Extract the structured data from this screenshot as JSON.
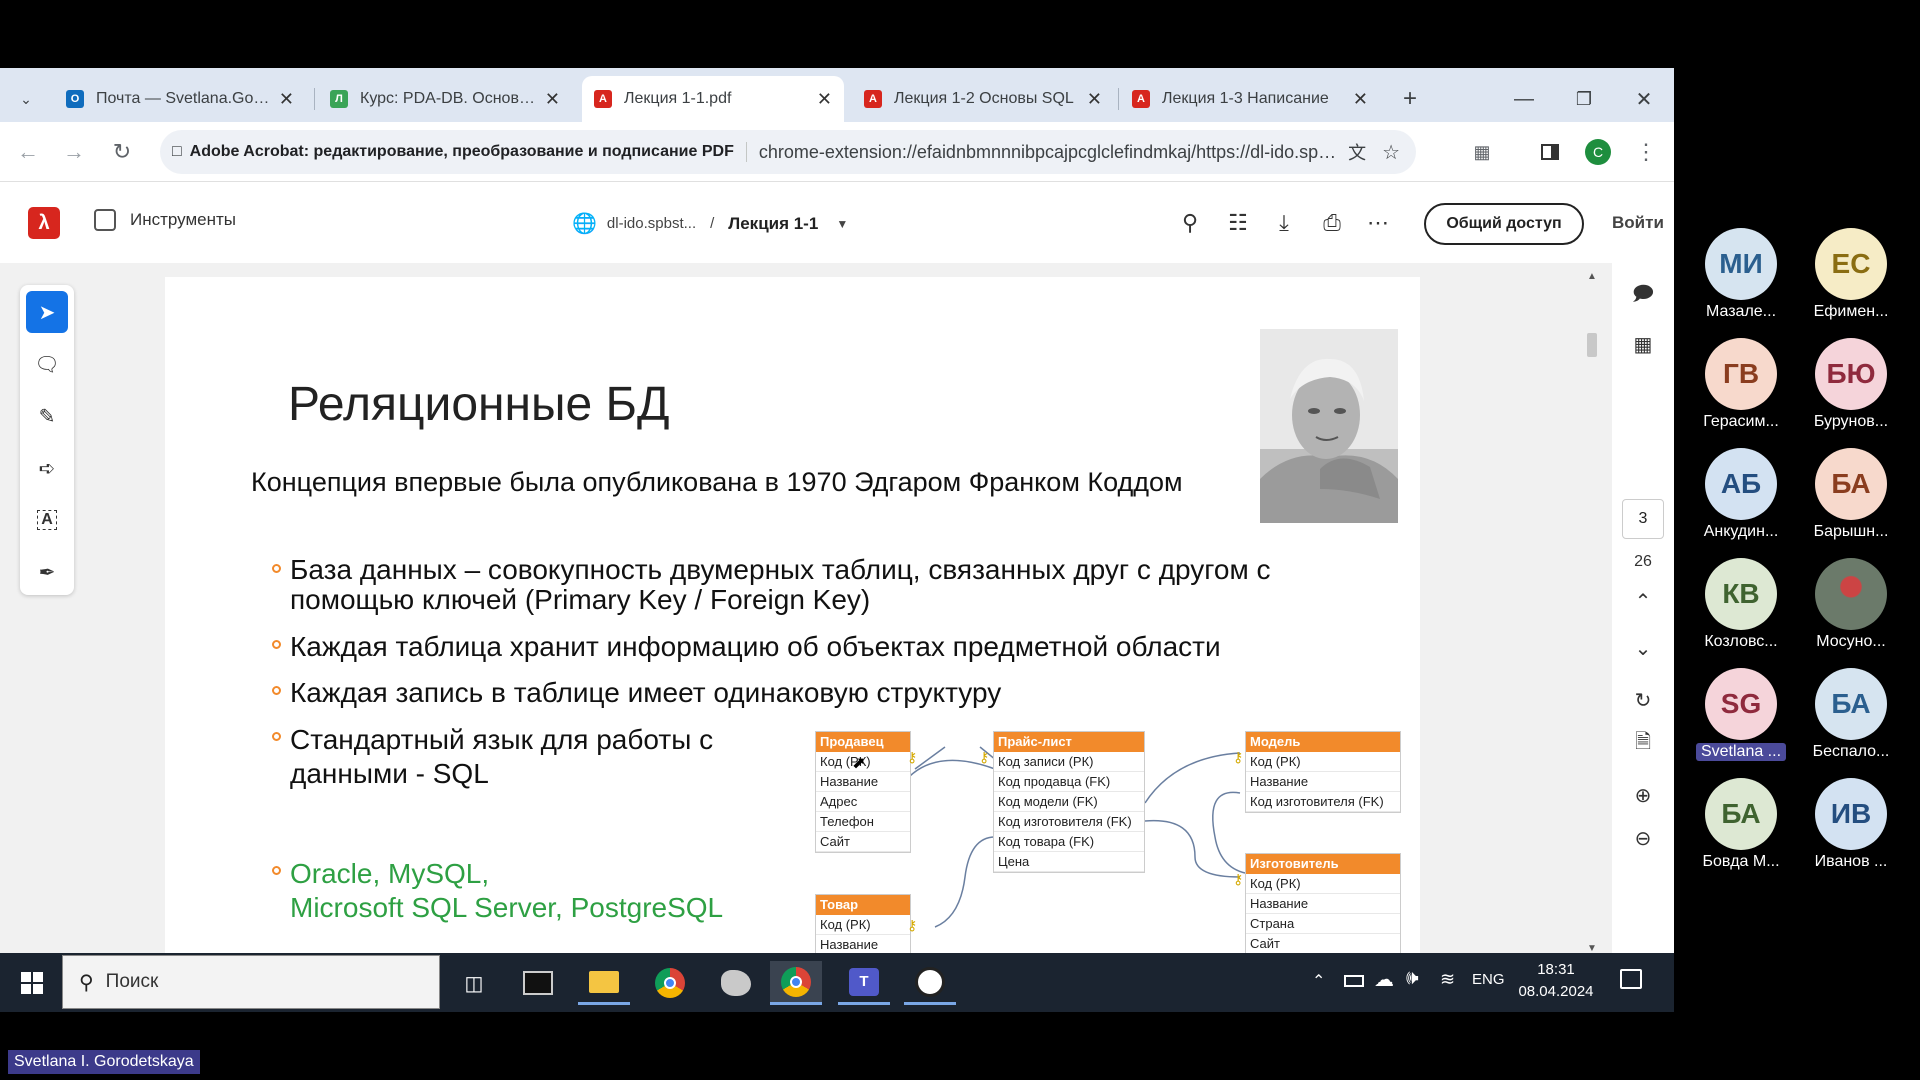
{
  "tabs": [
    {
      "title": "Почта — Svetlana.Gorod",
      "icon": "outlook-icon",
      "color": "#0f6cbd"
    },
    {
      "title": "Курс: PDA-DB. Основы б",
      "icon": "lms-icon",
      "color": "#3aa457"
    },
    {
      "title": "Лекция 1-1.pdf",
      "icon": "acrobat-icon",
      "color": "#d7261e",
      "active": true
    },
    {
      "title": "Лекция 1-2 Основы SQL",
      "icon": "acrobat-icon",
      "color": "#d7261e"
    },
    {
      "title": "Лекция 1-3 Написание",
      "icon": "acrobat-icon",
      "color": "#d7261e"
    }
  ],
  "address": {
    "site_label": "Adobe Acrobat: редактирование, преобразование и подписание PDF",
    "url": "chrome-extension://efaidnbmnnnibpcajpcglclefindmkaj/https://dl-ido.spbst...",
    "profile_initial": "C"
  },
  "acrobat": {
    "tools_label": "Инструменты",
    "breadcrumb_site": "dl-ido.spbst...",
    "breadcrumb_sep": "/",
    "doc_name": "Лекция 1-1",
    "share_label": "Общий доступ",
    "signin_label": "Войти",
    "current_page": "3",
    "total_pages": "26"
  },
  "slide": {
    "title": "Реляционные БД",
    "subtitle": "Концепция впервые была опубликована в 1970 Эдгаром Франком Коддом",
    "bullets": [
      "База данных – совокупность  двумерных таблиц, связанных друг с другом с помощью ключей (Primary Key / Foreign Key)",
      "Каждая таблица хранит информацию об объектах предметной области",
      "Каждая запись в таблице имеет одинаковую структуру",
      "Стандартный язык для работы с данными - SQL"
    ],
    "green_bullet_line1": "Oracle, MySQL,",
    "green_bullet_line2": "Microsoft SQL Server, PostgreSQL",
    "green_color": "#2ea043"
  },
  "erd": {
    "seller": {
      "header": "Продавец",
      "rows": [
        "Код (РК)",
        "Название",
        "Адрес",
        "Телефон",
        "Сайт"
      ]
    },
    "pricelist": {
      "header": "Прайс-лист",
      "rows": [
        "Код записи (РК)",
        "Код продавца (FK)",
        "Код модели (FK)",
        "Код изготовителя (FK)",
        "Код товара (FK)",
        "Цена"
      ]
    },
    "model": {
      "header": "Модель",
      "rows": [
        "Код (РК)",
        "Название",
        "Код изготовителя (FK)"
      ]
    },
    "manufacturer": {
      "header": "Изготовитель",
      "rows": [
        "Код (РК)",
        "Название",
        "Страна",
        "Сайт"
      ]
    },
    "product": {
      "header": "Товар",
      "rows": [
        "Код (РК)",
        "Название"
      ]
    }
  },
  "taskbar": {
    "search_placeholder": "Поиск",
    "lang": "ENG",
    "time": "18:31",
    "date": "08.04.2024"
  },
  "participants": [
    {
      "initials": "МИ",
      "name": "Мазале...",
      "bg": "#d6e4f0",
      "fg": "#2b5f8f"
    },
    {
      "initials": "ЕС",
      "name": "Ефимен...",
      "bg": "#f6ecc6",
      "fg": "#8a6d12"
    },
    {
      "initials": "ГВ",
      "name": "Герасим...",
      "bg": "#f7d9cc",
      "fg": "#8a3d1f"
    },
    {
      "initials": "БЮ",
      "name": "Бурунов...",
      "bg": "#f5d4da",
      "fg": "#8f2a3d"
    },
    {
      "initials": "АБ",
      "name": "Анкудин...",
      "bg": "#d3e2f2",
      "fg": "#244e80"
    },
    {
      "initials": "БА",
      "name": "Барышн...",
      "bg": "#f7d9cc",
      "fg": "#8a3d1f"
    },
    {
      "initials": "КВ",
      "name": "Козловс...",
      "bg": "#dde8d3",
      "fg": "#3f6330"
    },
    {
      "initials": "",
      "name": "Мосуно...",
      "bg": "#6b7a6a",
      "fg": "#ffffff"
    },
    {
      "initials": "SG",
      "name": "Svetlana ...",
      "bg": "#f5d4da",
      "fg": "#8f2a3d",
      "highlight": true
    },
    {
      "initials": "БА",
      "name": "Беспало...",
      "bg": "#d6e4f0",
      "fg": "#2b5f8f"
    },
    {
      "initials": "БА",
      "name": "Бовда М...",
      "bg": "#dde8d3",
      "fg": "#3f6330"
    },
    {
      "initials": "ИВ",
      "name": "Иванов ...",
      "bg": "#d3e2f2",
      "fg": "#244e80"
    }
  ],
  "presenter_label": "Svetlana I. Gorodetskaya"
}
